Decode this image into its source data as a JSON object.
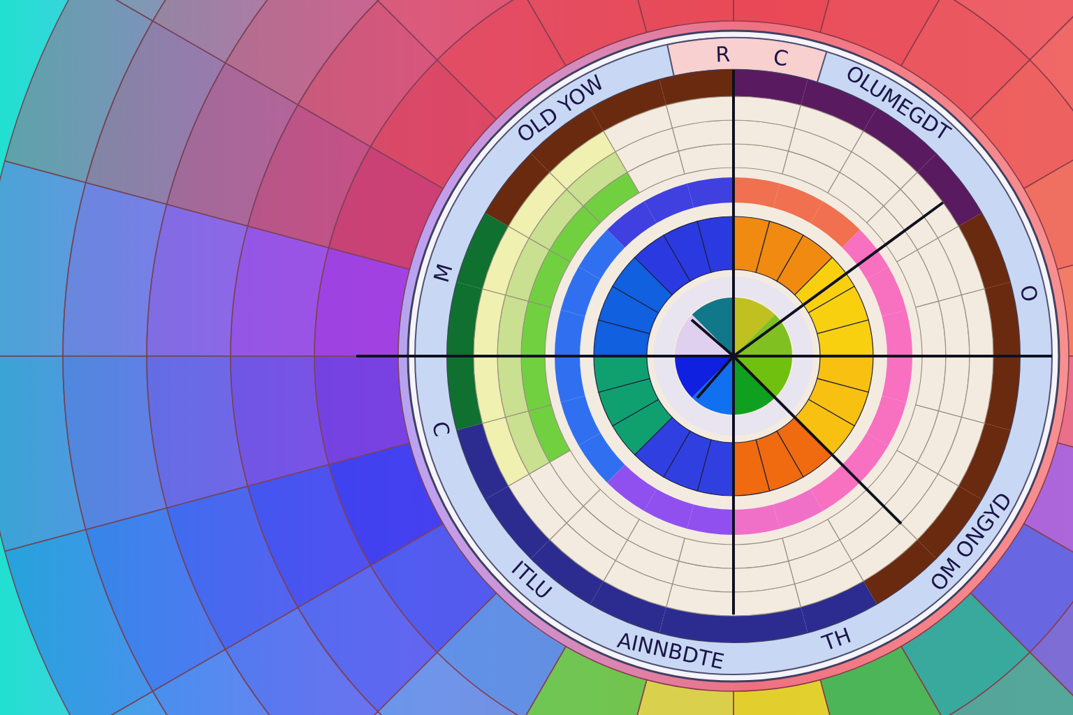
{
  "labels": [
    {
      "text": "OLD YOW"
    },
    {
      "text": "R"
    },
    {
      "text": "C"
    },
    {
      "text": "OLUMEGDT"
    },
    {
      "text": "M"
    },
    {
      "text": "O"
    },
    {
      "text": "C"
    },
    {
      "text": "ITLU"
    },
    {
      "text": "AINNBDTE"
    },
    {
      "text": "TH"
    },
    {
      "text": "OM ONGYD"
    }
  ]
}
